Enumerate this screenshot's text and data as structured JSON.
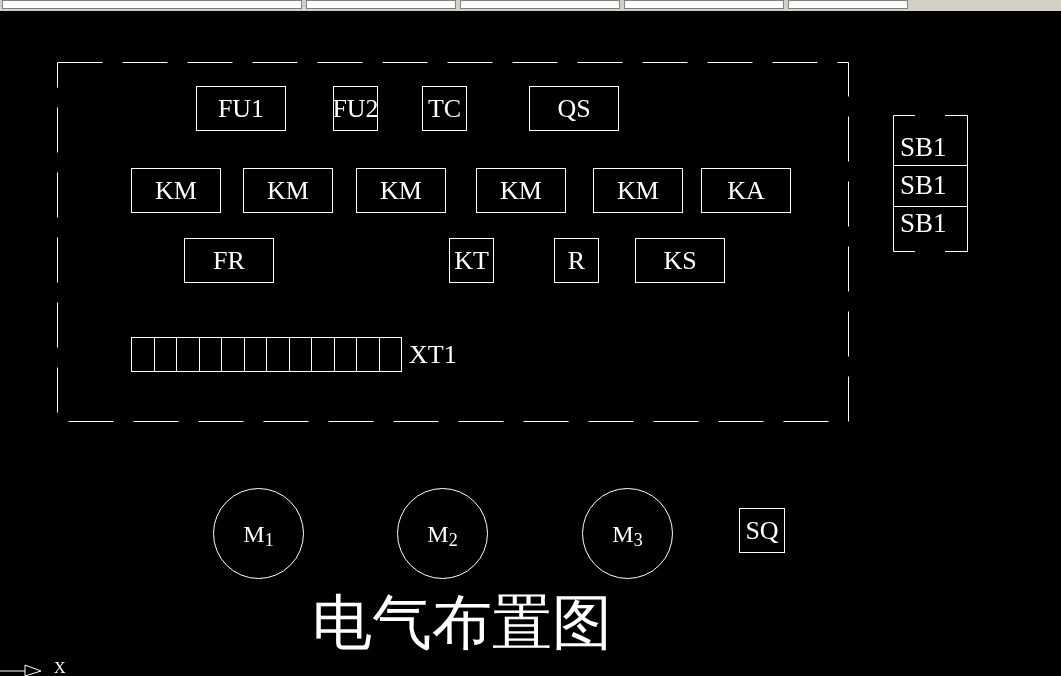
{
  "drawing": {
    "panel_components": [
      {
        "label": "FU1"
      },
      {
        "label": "FU2"
      },
      {
        "label": "TC"
      },
      {
        "label": "QS"
      },
      {
        "label": "KM"
      },
      {
        "label": "KM"
      },
      {
        "label": "KM"
      },
      {
        "label": "KM"
      },
      {
        "label": "KM"
      },
      {
        "label": "KA"
      },
      {
        "label": "FR"
      },
      {
        "label": "KT"
      },
      {
        "label": "R"
      },
      {
        "label": "KS"
      }
    ],
    "terminal_strip": {
      "label": "XT1"
    },
    "push_buttons": [
      {
        "label": "SB1"
      },
      {
        "label": "SB1"
      },
      {
        "label": "SB1"
      }
    ],
    "motors": [
      {
        "label": "M$_{1}$"
      },
      {
        "label": "M$_{2}$"
      },
      {
        "label": "M$_{3}$"
      }
    ],
    "limit_switch": {
      "label": "SQ"
    },
    "title": "电气布置图",
    "axis_label": "X"
  }
}
